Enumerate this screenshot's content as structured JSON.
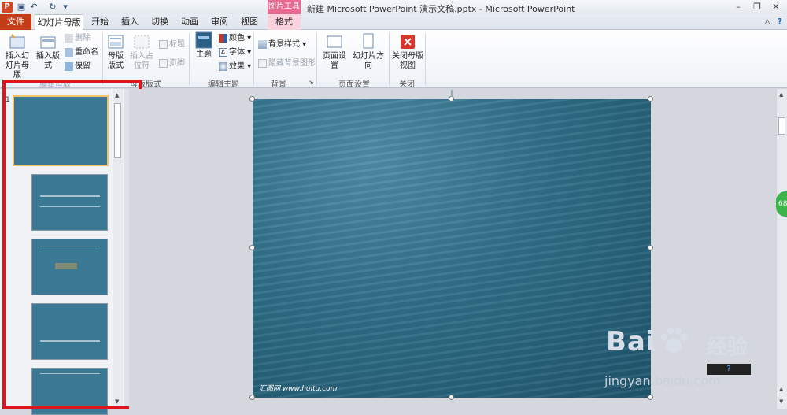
{
  "title_bar": {
    "app_letter": "P",
    "window_title": "新建 Microsoft PowerPoint 演示文稿.pptx - Microsoft PowerPoint",
    "contextual_tool_label": "图片工具"
  },
  "tabs": [
    "文件",
    "幻灯片母版",
    "开始",
    "插入",
    "切换",
    "动画",
    "审阅",
    "视图",
    "格式"
  ],
  "ribbon": {
    "edit_master": {
      "insert_slide_master": "插入幻灯片母版",
      "insert_layout": "插入版式",
      "delete": "删除",
      "rename": "重命名",
      "preserve": "保留",
      "group_label": "编辑母版"
    },
    "master_layout": {
      "master_layout_btn": "母版版式",
      "insert_placeholder": "插入占位符",
      "title_chk": "标题",
      "footer_chk": "页脚",
      "group_label": "母版版式"
    },
    "edit_theme": {
      "theme": "主题",
      "colors": "颜色",
      "fonts": "字体",
      "effects": "效果",
      "group_label": "编辑主题"
    },
    "background": {
      "background_styles": "背景样式",
      "hide_background": "隐藏背景图形",
      "group_label": "背景"
    },
    "page_setup": {
      "page_setup": "页面设置",
      "slide_orientation": "幻灯片方向",
      "group_label": "页面设置"
    },
    "close": {
      "close_master": "关闭母版视图",
      "group_label": "关闭"
    }
  },
  "thumbnails": {
    "first_number": "1",
    "count": 5
  },
  "slide": {
    "watermark": "汇图网 www.huitu.com"
  },
  "overlay": {
    "baidu_text": "Bai",
    "baidu_cn": "经验",
    "baidu_url": "jingyan.baidu.com",
    "green_badge": "68",
    "help_label": "?"
  },
  "colors": {
    "file_tab": "#c33d17",
    "context_tab": "#e86a93",
    "highlight_box": "#e0141b",
    "selected_thumb_border": "#f0c46a"
  }
}
